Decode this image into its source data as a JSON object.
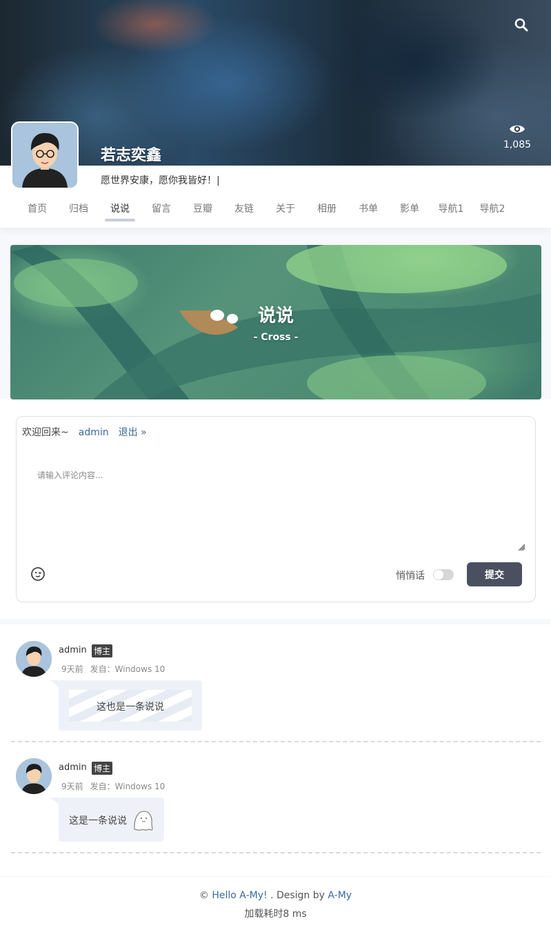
{
  "header": {
    "site_name": "若志奕鑫",
    "motto": "愿世界安康，愿你我皆好！|",
    "view_count": "1,085",
    "search_icon": "search-icon",
    "views_icon": "eye-icon"
  },
  "nav": {
    "items": [
      {
        "label": "首页",
        "active": false
      },
      {
        "label": "归档",
        "active": false
      },
      {
        "label": "说说",
        "active": true
      },
      {
        "label": "留言",
        "active": false
      },
      {
        "label": "豆瓣",
        "active": false
      },
      {
        "label": "友链",
        "active": false
      },
      {
        "label": "关于",
        "active": false
      },
      {
        "label": "相册",
        "active": false
      },
      {
        "label": "书单",
        "active": false
      },
      {
        "label": "影单",
        "active": false
      },
      {
        "label": "导航1",
        "active": false
      },
      {
        "label": "导航2",
        "active": false
      }
    ]
  },
  "banner": {
    "title": "说说",
    "subtitle": "- Cross -"
  },
  "comment_form": {
    "welcome": "欢迎回来~",
    "user": "admin",
    "logout": "退出 »",
    "placeholder": "请输入评论内容...",
    "value": "",
    "emoji_icon": "emoji-icon",
    "whisper_label": "悄悄话",
    "whisper_on": false,
    "submit_label": "提交"
  },
  "posts": [
    {
      "author": "admin",
      "badge": "博主",
      "time": "9天前",
      "source": "发自：Windows 10",
      "content": "这也是一条说说"
    },
    {
      "author": "admin",
      "badge": "博主",
      "time": "9天前",
      "source": "发自：Windows 10",
      "content": "这是一条说说"
    }
  ],
  "footer": {
    "copyright": "©",
    "site_link": "Hello A-My!",
    "design_text": ". Design by",
    "author_link": "A-My",
    "load_time": "加载耗时8 ms"
  },
  "colors": {
    "accent": "#3a6a9a",
    "button": "#4a5060",
    "badge": "#444444",
    "bubble": "#eef1f8"
  }
}
